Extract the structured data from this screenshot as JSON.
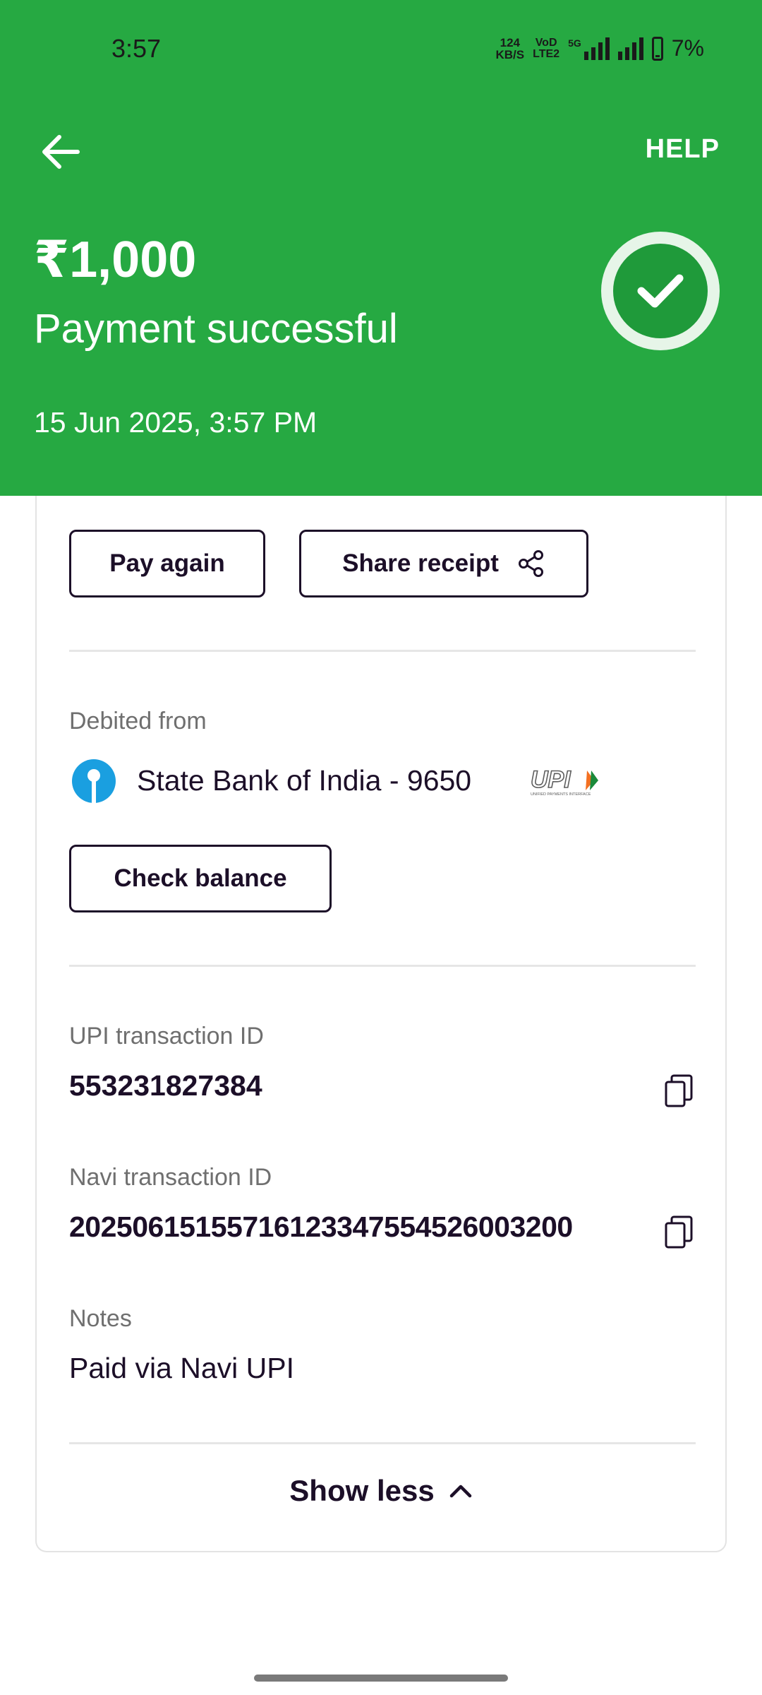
{
  "status_bar": {
    "time": "3:57",
    "net_speed_value": "124",
    "net_speed_unit": "KB/S",
    "volte_top": "VoD",
    "volte_bottom": "LTE2",
    "network_tag": "5G",
    "battery_text": "7%"
  },
  "header": {
    "help_label": "HELP",
    "amount": "₹1,000",
    "status": "Payment successful",
    "datetime": "15 Jun 2025, 3:57 PM",
    "accent_color": "#26a942"
  },
  "actions": {
    "pay_again_label": "Pay again",
    "share_receipt_label": "Share receipt"
  },
  "debit": {
    "label": "Debited from",
    "bank": "State Bank of India - 9650",
    "upi_logo_text": "UPI",
    "upi_logo_subtext": "UNIFIED PAYMENTS INTERFACE",
    "check_balance_label": "Check balance"
  },
  "upi_txn": {
    "label": "UPI transaction ID",
    "value": "553231827384"
  },
  "navi_txn": {
    "label": "Navi transaction ID",
    "value": "202506151557161233475545260032​00"
  },
  "notes": {
    "label": "Notes",
    "value": "Paid via Navi UPI"
  },
  "footer": {
    "show_less_label": "Show less"
  }
}
